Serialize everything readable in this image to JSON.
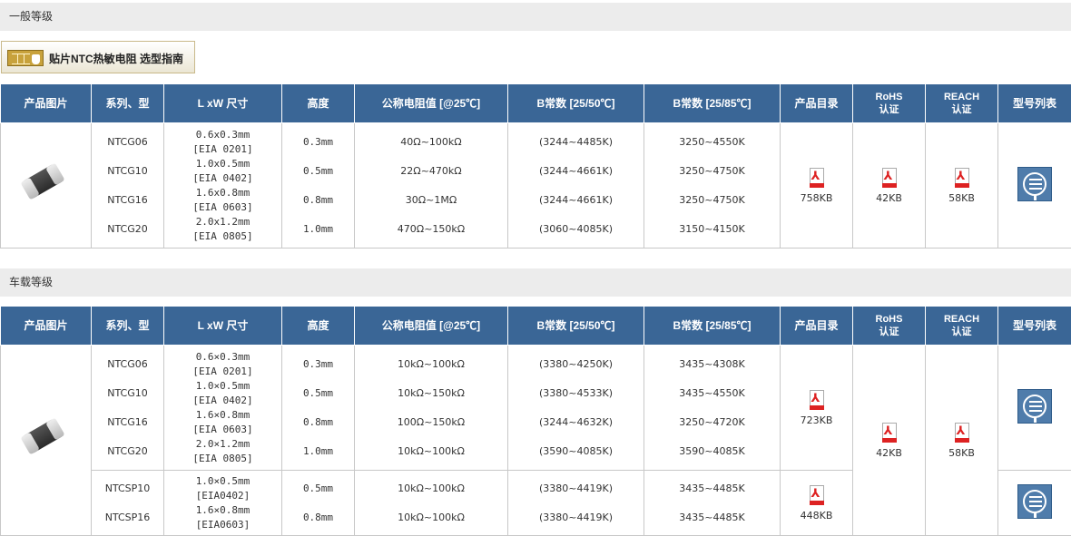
{
  "sections": {
    "general": "一般等级",
    "automotive": "车载等级"
  },
  "guide_button": {
    "label": "贴片NTC热敏电阻 选型指南",
    "icon": "hand-pointer-grid-icon"
  },
  "table_headers": [
    "产品图片",
    "系列、型",
    "L xW 尺寸",
    "高度",
    "公称电阻值 [@25℃]",
    "B常数 [25/50℃]",
    "B常数 [25/85℃]",
    "产品目录",
    "RoHS\n认证",
    "REACH\n认证",
    "型号列表"
  ],
  "general": {
    "rows": [
      {
        "series": "NTCG06",
        "size1": "0.6x0.3mm",
        "size2": "[EIA 0201]",
        "height": "0.3mm",
        "resistance": "40Ω~100kΩ",
        "b2550": "(3244~4485K)",
        "b2585": "3250~4550K"
      },
      {
        "series": "NTCG10",
        "size1": "1.0x0.5mm",
        "size2": "[EIA 0402]",
        "height": "0.5mm",
        "resistance": "22Ω~470kΩ",
        "b2550": "(3244~4661K)",
        "b2585": "3250~4750K"
      },
      {
        "series": "NTCG16",
        "size1": "1.6x0.8mm",
        "size2": "[EIA 0603]",
        "height": "0.8mm",
        "resistance": "30Ω~1MΩ",
        "b2550": "(3244~4661K)",
        "b2585": "3250~4750K"
      },
      {
        "series": "NTCG20",
        "size1": "2.0x1.2mm",
        "size2": "[EIA 0805]",
        "height": "1.0mm",
        "resistance": "470Ω~150kΩ",
        "b2550": "(3060~4085K)",
        "b2585": "3150~4150K"
      }
    ],
    "catalog": "758KB",
    "rohs": "42KB",
    "reach": "58KB"
  },
  "automotive": {
    "rows": [
      {
        "series": "NTCG06",
        "size1": "0.6×0.3mm",
        "size2": "[EIA 0201]",
        "height": "0.3mm",
        "resistance": "10kΩ~100kΩ",
        "b2550": "(3380~4250K)",
        "b2585": "3435~4308K"
      },
      {
        "series": "NTCG10",
        "size1": "1.0×0.5mm",
        "size2": "[EIA 0402]",
        "height": "0.5mm",
        "resistance": "10kΩ~150kΩ",
        "b2550": "(3380~4533K)",
        "b2585": "3435~4550K"
      },
      {
        "series": "NTCG16",
        "size1": "1.6×0.8mm",
        "size2": "[EIA 0603]",
        "height": "0.8mm",
        "resistance": "100Ω~150kΩ",
        "b2550": "(3244~4632K)",
        "b2585": "3250~4720K"
      },
      {
        "series": "NTCG20",
        "size1": "2.0×1.2mm",
        "size2": "[EIA 0805]",
        "height": "1.0mm",
        "resistance": "10kΩ~100kΩ",
        "b2550": "(3590~4085K)",
        "b2585": "3590~4085K"
      },
      {
        "series": "NTCSP10",
        "size1": "1.0×0.5mm",
        "size2": "[EIA0402]",
        "height": "0.5mm",
        "resistance": "10kΩ~100kΩ",
        "b2550": "(3380~4419K)",
        "b2585": "3435~4485K"
      },
      {
        "series": "NTCSP16",
        "size1": "1.6×0.8mm",
        "size2": "[EIA0603]",
        "height": "0.8mm",
        "resistance": "10kΩ~100kΩ",
        "b2550": "(3380~4419K)",
        "b2585": "3435~4485K"
      }
    ],
    "catalog_g": "723KB",
    "catalog_sp": "448KB",
    "rohs": "42KB",
    "reach": "58KB"
  },
  "colors": {
    "header_bg": "#3a6696",
    "section_bg": "#ececec",
    "pdf_red": "#d22"
  }
}
